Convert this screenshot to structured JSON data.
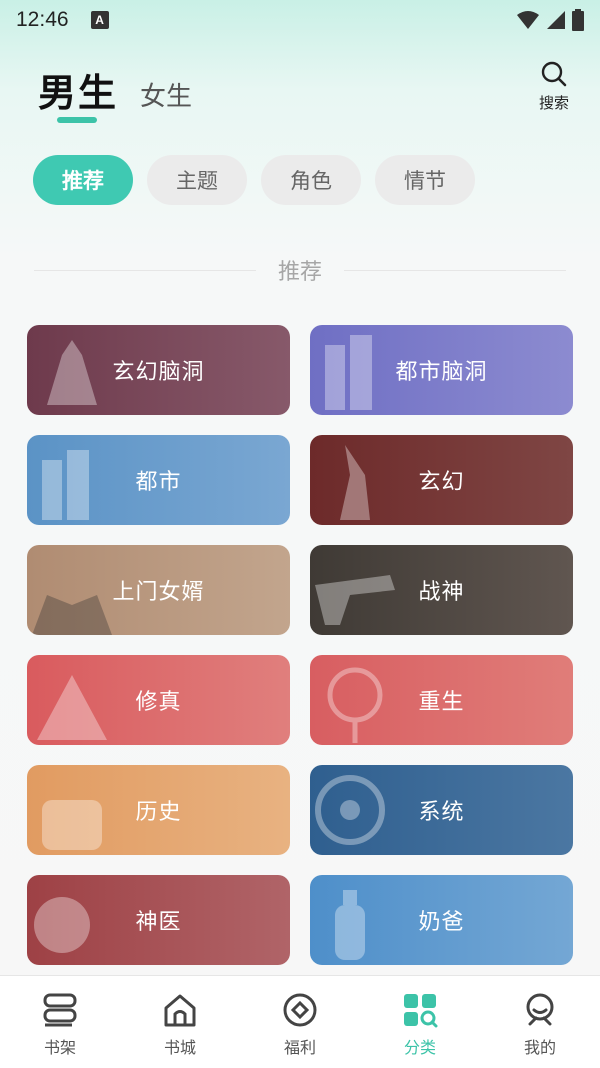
{
  "status_bar": {
    "time": "12:46",
    "badge": "A"
  },
  "header": {
    "gender_tabs": [
      {
        "label": "男生",
        "active": true
      },
      {
        "label": "女生",
        "active": false
      }
    ],
    "search_label": "搜索"
  },
  "chips": [
    {
      "label": "推荐",
      "active": true
    },
    {
      "label": "主题",
      "active": false
    },
    {
      "label": "角色",
      "active": false
    },
    {
      "label": "情节",
      "active": false
    }
  ],
  "section_title": "推荐",
  "categories": [
    {
      "label": "玄幻脑洞",
      "color_from": "#6e3a4c",
      "color_to": "#87596a"
    },
    {
      "label": "都市脑洞",
      "color_from": "#6f6fc4",
      "color_to": "#8c8bd0"
    },
    {
      "label": "都市",
      "color_from": "#5b93c6",
      "color_to": "#7aa7d2"
    },
    {
      "label": "玄幻",
      "color_from": "#6d2a2a",
      "color_to": "#7f4644"
    },
    {
      "label": "上门女婿",
      "color_from": "#b08c72",
      "color_to": "#c2a58d"
    },
    {
      "label": "战神",
      "color_from": "#3f3a35",
      "color_to": "#605650"
    },
    {
      "label": "修真",
      "color_from": "#d95b5e",
      "color_to": "#e07f7d"
    },
    {
      "label": "重生",
      "color_from": "#d85e61",
      "color_to": "#e07d79"
    },
    {
      "label": "历史",
      "color_from": "#e19b61",
      "color_to": "#e8b281"
    },
    {
      "label": "系统",
      "color_from": "#2f5f8f",
      "color_to": "#4b77a2"
    },
    {
      "label": "神医",
      "color_from": "#9e4145",
      "color_to": "#b06468"
    },
    {
      "label": "奶爸",
      "color_from": "#4e8fca",
      "color_to": "#74a7d4"
    }
  ],
  "bottom_nav": [
    {
      "label": "书架",
      "icon": "bookshelf-icon",
      "active": false
    },
    {
      "label": "书城",
      "icon": "home-icon",
      "active": false
    },
    {
      "label": "福利",
      "icon": "welfare-icon",
      "active": false
    },
    {
      "label": "分类",
      "icon": "category-icon",
      "active": true
    },
    {
      "label": "我的",
      "icon": "profile-icon",
      "active": false
    }
  ],
  "colors": {
    "accent": "#3cc3a8",
    "chip_active": "#3fc9b2",
    "chip_inactive": "#ebebeb"
  }
}
